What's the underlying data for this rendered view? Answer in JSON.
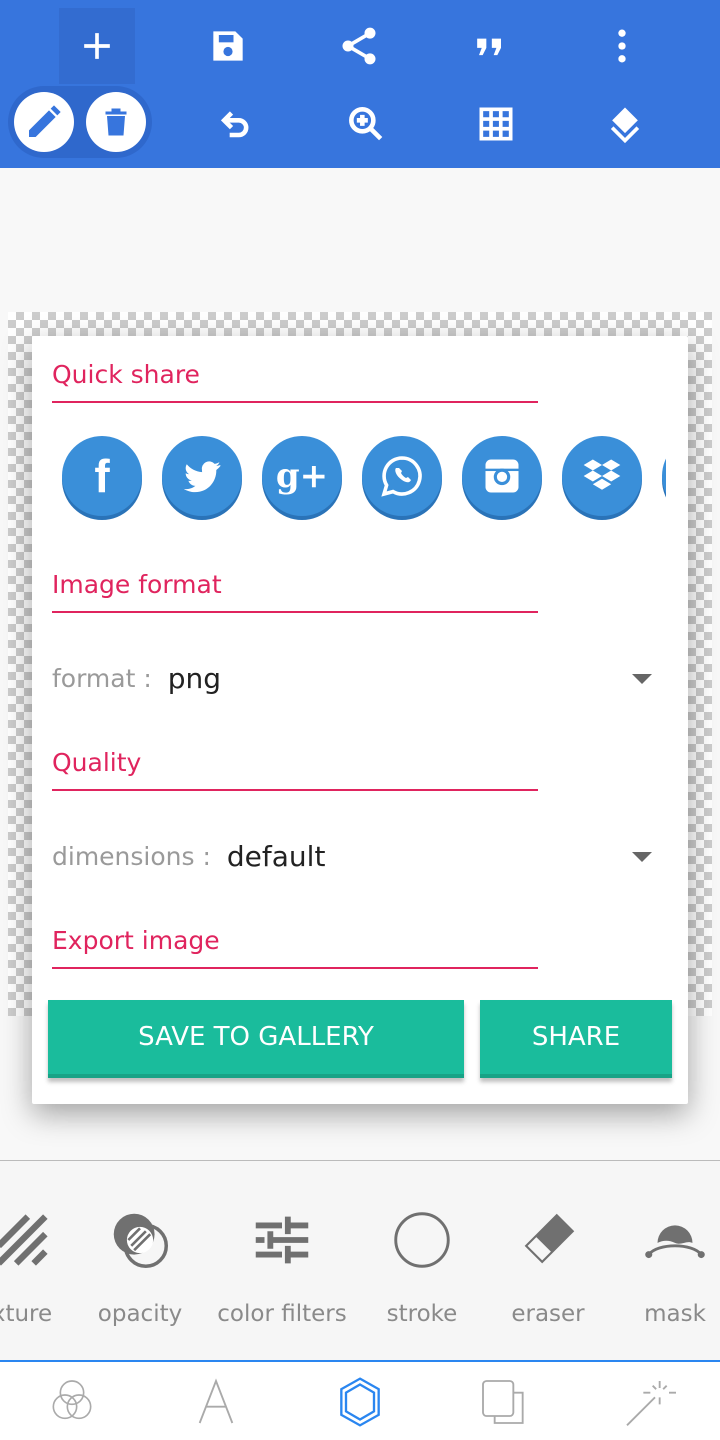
{
  "toolbar": {
    "icons": [
      "add-icon",
      "save-icon",
      "share-icon",
      "quote-icon",
      "more-vert-icon",
      "pencil-icon",
      "trash-icon",
      "undo-icon",
      "zoom-in-icon",
      "grid-icon",
      "layers-icon"
    ],
    "color": "#3775dd"
  },
  "dialog": {
    "quick_share": "Quick share",
    "social": [
      "facebook",
      "twitter",
      "google-plus",
      "whatsapp",
      "instagram",
      "dropbox"
    ],
    "image_format": "Image format",
    "format_label": "format :",
    "format_value": "png",
    "quality": "Quality",
    "dimensions_label": "dimensions :",
    "dimensions_value": "default",
    "export_image": "Export image",
    "save_label": "SAVE TO GALLERY",
    "share_label": "SHARE",
    "accent": "#e0245e",
    "button_color": "#1abc9c"
  },
  "tools": [
    {
      "label": "xture"
    },
    {
      "label": "opacity"
    },
    {
      "label": "color filters"
    },
    {
      "label": "stroke"
    },
    {
      "label": "eraser"
    },
    {
      "label": "mask"
    }
  ],
  "nav": {
    "icons": [
      "blend-icon",
      "text-icon",
      "shape-icon",
      "duplicate-icon",
      "magic-wand-icon"
    ],
    "active": "shape-icon",
    "active_color": "#2a86f0"
  }
}
